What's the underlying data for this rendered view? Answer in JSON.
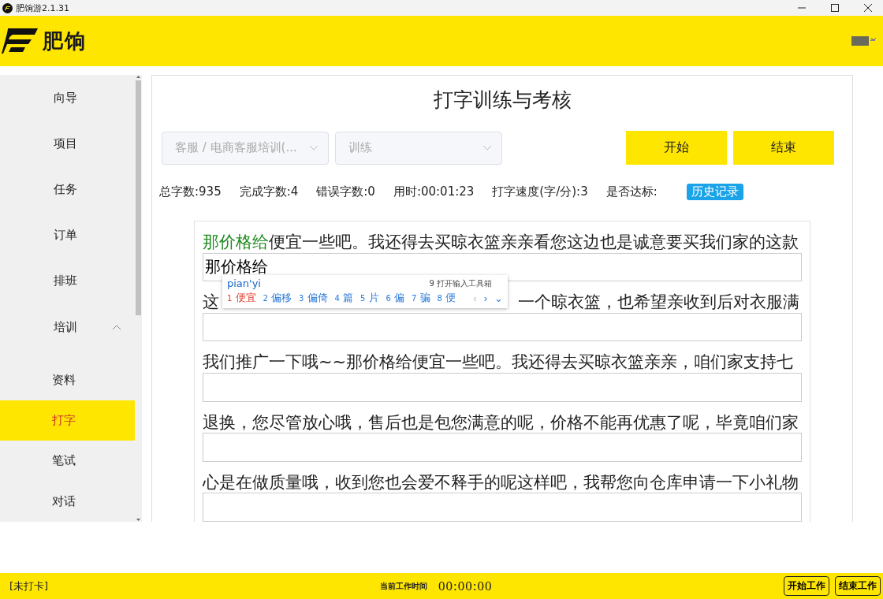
{
  "window": {
    "title": "肥饷游2.1.31"
  },
  "header": {
    "brand": "肥饷"
  },
  "sidebar": {
    "items": [
      {
        "label": "向导",
        "selected": false
      },
      {
        "label": "项目",
        "selected": false
      },
      {
        "label": "任务",
        "selected": false
      },
      {
        "label": "订单",
        "selected": false
      },
      {
        "label": "排班",
        "selected": false
      },
      {
        "label": "培训",
        "selected": false,
        "expanded": true,
        "children": [
          {
            "label": "资料",
            "selected": false
          },
          {
            "label": "打字",
            "selected": true
          },
          {
            "label": "笔试",
            "selected": false
          },
          {
            "label": "对话",
            "selected": false
          }
        ]
      }
    ]
  },
  "page": {
    "title": "打字训练与考核",
    "selects": [
      {
        "value": "客服 / 电商客服培训(...",
        "disabled": true
      },
      {
        "value": "训练",
        "disabled": true
      }
    ],
    "buttons": [
      "开始",
      "结束"
    ],
    "stats": [
      "总字数:935",
      "完成字数:4",
      "错误字数:0",
      "用时:00:01:23",
      "打字速度(字/分):3",
      "是否达标:"
    ],
    "history_button": "历史记录",
    "lines": [
      {
        "done": "那价格给",
        "rest": "便宜一些吧。我还得去买晾衣篮亲亲看您这边也是诚意要买我们家的这款",
        "typed": "那价格给"
      },
      {
        "rest": "这",
        "after_covered": "一个晾衣篮，也希望亲收到后对衣服满"
      },
      {
        "rest": "我们推广一下哦~~那价格给便宜一些吧。我还得去买晾衣篮亲亲，咱们家支持七"
      },
      {
        "rest": "退换，您尽管放心哦，售后也是包您满意的呢，价格不能再优惠了呢，毕竟咱们家"
      },
      {
        "rest": "心是在做质量哦，收到您也会爱不释手的呢这样吧，我帮您向仓库申请一下小礼物"
      }
    ],
    "ime": {
      "composition": "pian'yi",
      "toolbox": "9 打开输入工具箱",
      "candidates": [
        {
          "index": "1",
          "text": "便宜",
          "selected": true
        },
        {
          "index": "2",
          "text": "偏移",
          "selected": false
        },
        {
          "index": "3",
          "text": "偏倚",
          "selected": false
        },
        {
          "index": "4",
          "text": "篇",
          "selected": false
        },
        {
          "index": "5",
          "text": "片",
          "selected": false
        },
        {
          "index": "6",
          "text": "偏",
          "selected": false
        },
        {
          "index": "7",
          "text": "骗",
          "selected": false
        },
        {
          "index": "8",
          "text": "便",
          "selected": false
        }
      ],
      "prev": "‹",
      "next": "›",
      "expand": "⌄"
    }
  },
  "footer": {
    "status": "[未打卡]",
    "time_label": "当前工作时间",
    "time": "00:00:00",
    "buttons": [
      "开始工作",
      "结束工作"
    ]
  }
}
